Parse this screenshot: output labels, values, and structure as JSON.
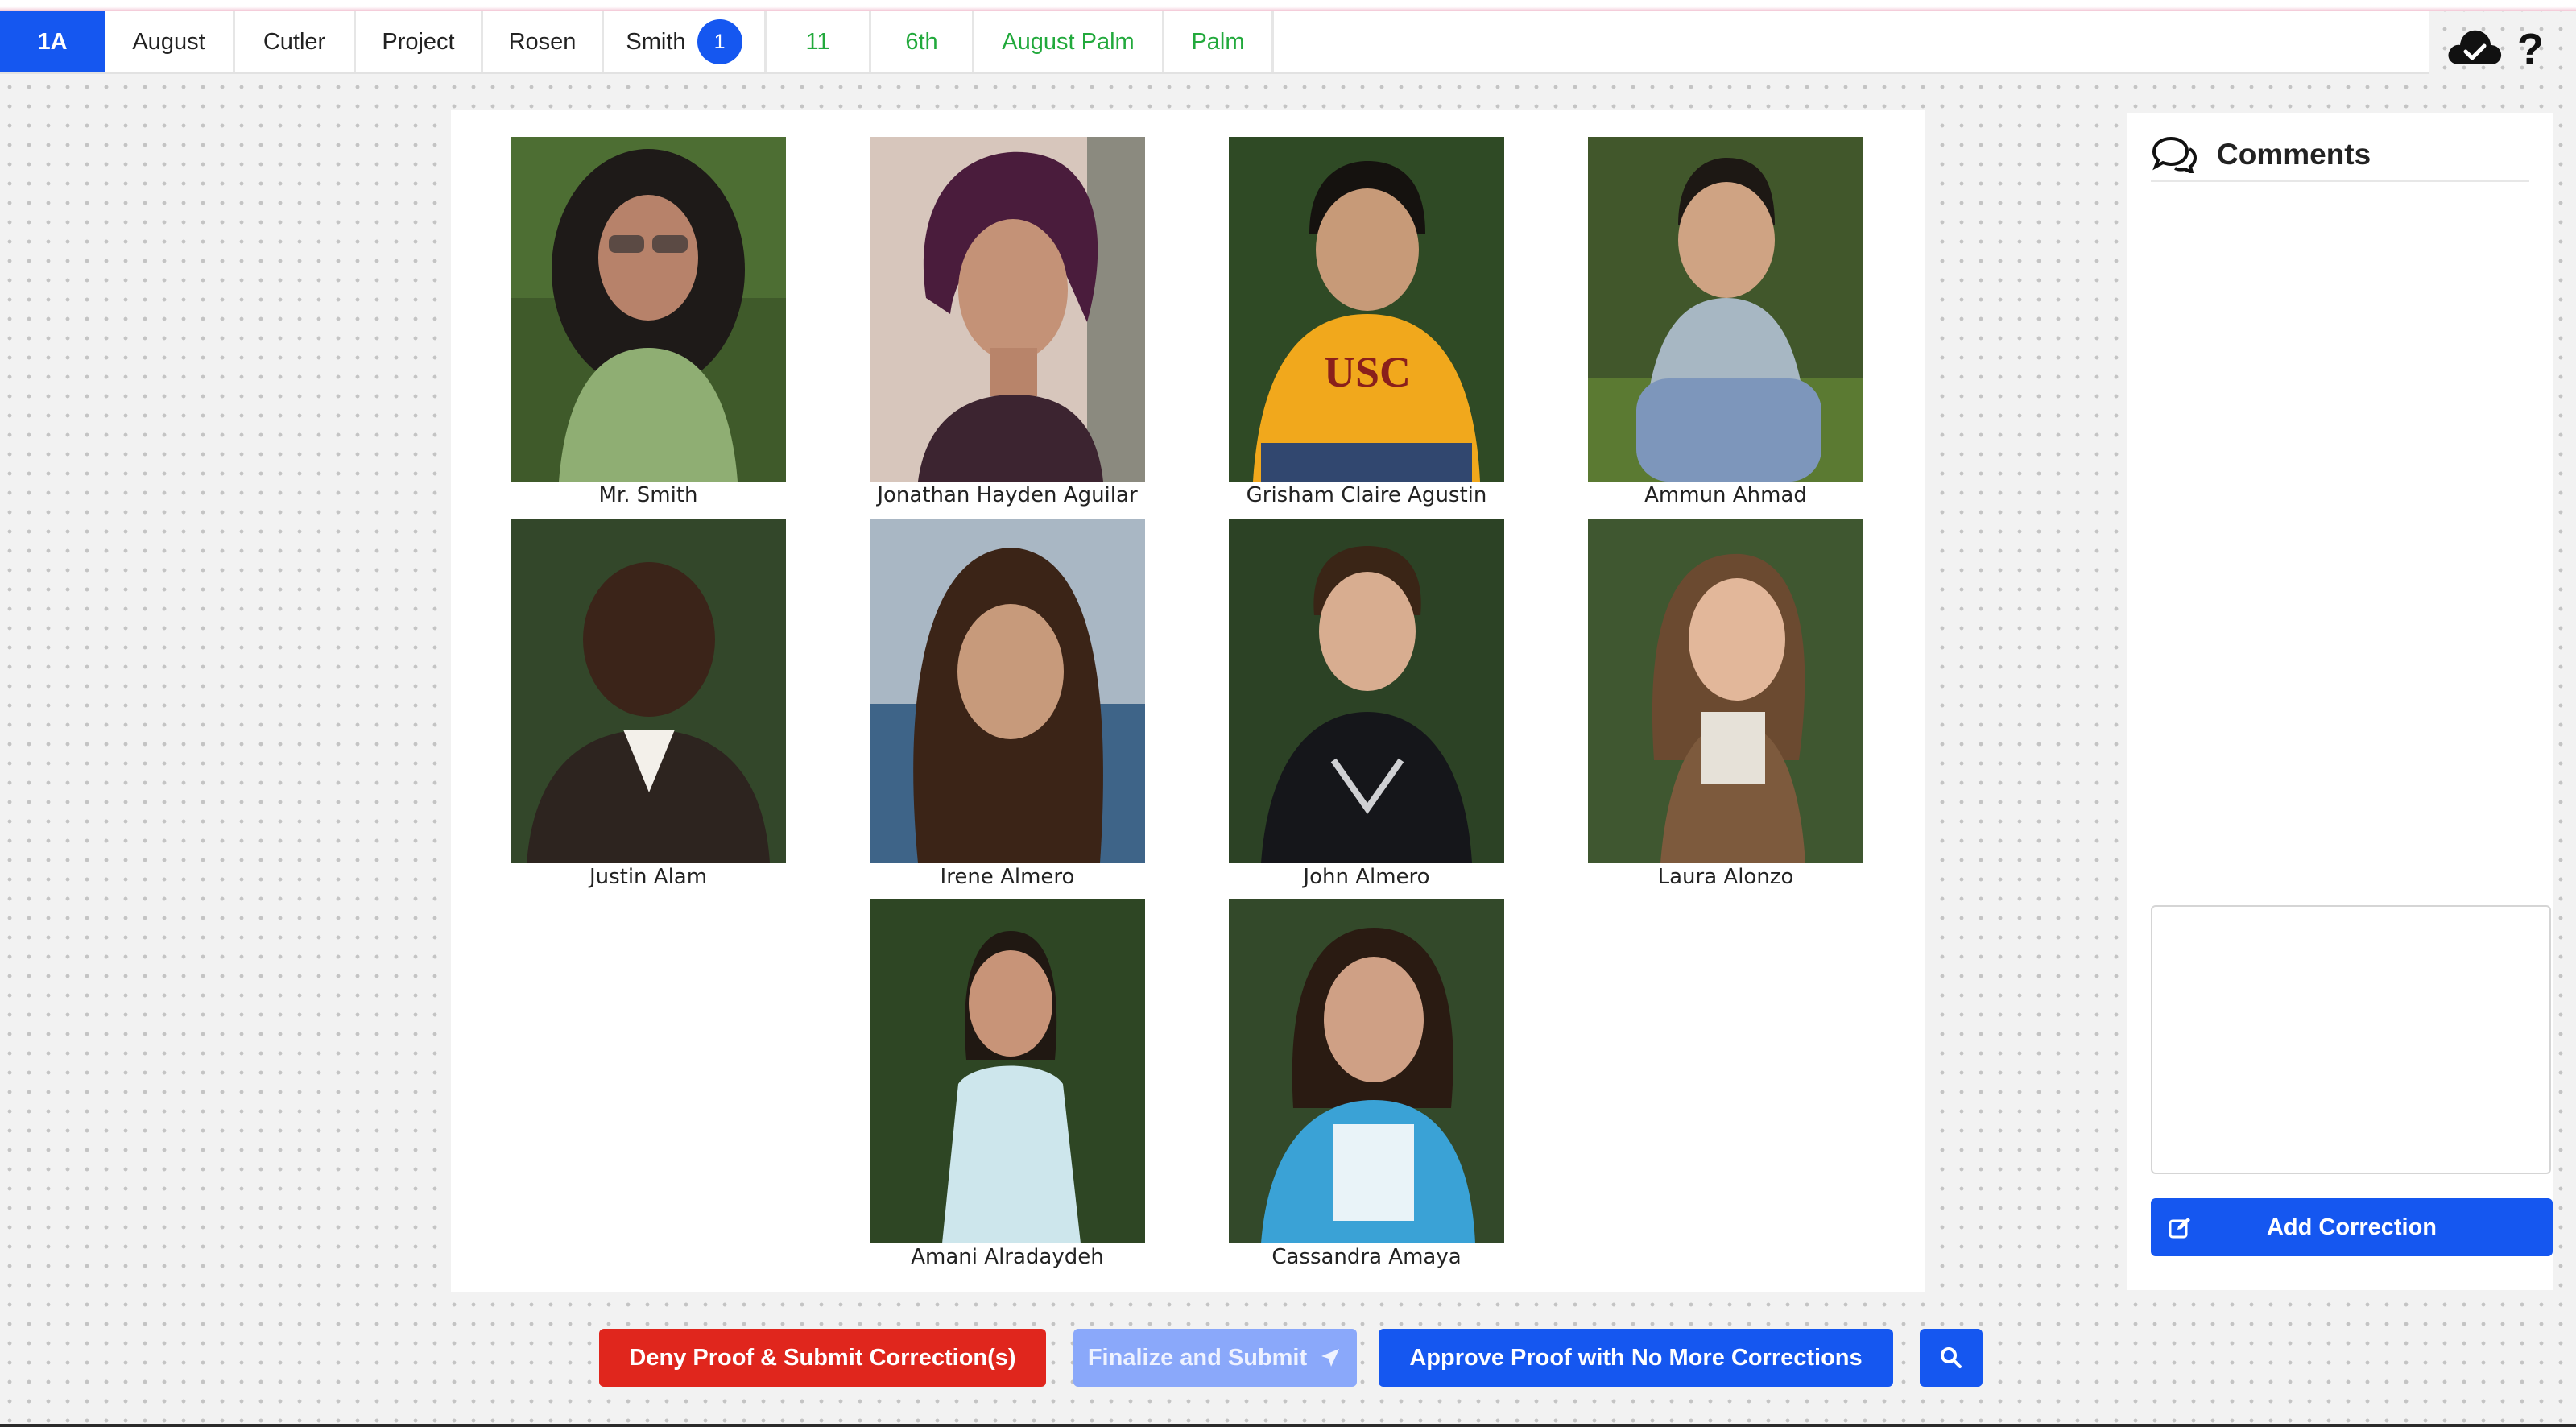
{
  "tabs": [
    {
      "label": "1A",
      "state": "active"
    },
    {
      "label": "August",
      "state": "normal"
    },
    {
      "label": "Cutler",
      "state": "normal"
    },
    {
      "label": "Project",
      "state": "normal"
    },
    {
      "label": "Rosen",
      "state": "normal"
    },
    {
      "label": "Smith",
      "state": "normal",
      "badge": "1"
    },
    {
      "label": "11",
      "state": "green"
    },
    {
      "label": "6th",
      "state": "green"
    },
    {
      "label": "August Palm",
      "state": "green"
    },
    {
      "label": "Palm",
      "state": "green"
    }
  ],
  "header_icons": {
    "cloud": "cloud-check-icon",
    "help": "?"
  },
  "photos": [
    {
      "name": "Mr. Smith"
    },
    {
      "name": "Jonathan Hayden Aguilar"
    },
    {
      "name": "Grisham Claire Agustin"
    },
    {
      "name": "Ammun Ahmad"
    },
    {
      "name": "Justin Alam"
    },
    {
      "name": "Irene Almero"
    },
    {
      "name": "John Almero"
    },
    {
      "name": "Laura Alonzo"
    },
    {
      "name": "Amani Alradaydeh"
    },
    {
      "name": "Cassandra Amaya"
    }
  ],
  "comments": {
    "title": "Comments",
    "input_value": "",
    "add_button": "Add Correction"
  },
  "actions": {
    "deny": "Deny Proof & Submit Correction(s)",
    "finalize": "Finalize and Submit",
    "approve": "Approve Proof with No More Corrections"
  },
  "colors": {
    "primary": "#1557f0",
    "danger": "#e0261d",
    "finalize_disabled": "#8aa8fa",
    "green_tab_text": "#22a93c"
  }
}
